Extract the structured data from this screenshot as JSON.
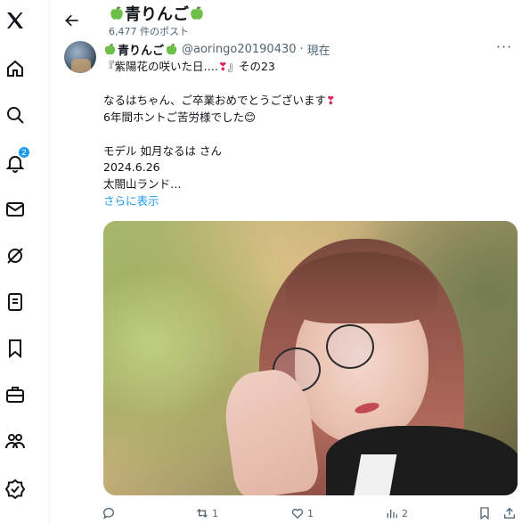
{
  "header": {
    "title": "青りんご",
    "subtitle": "6,477 件のポスト"
  },
  "sidebar": {
    "items": [
      {
        "name": "x-logo-icon"
      },
      {
        "name": "home-icon"
      },
      {
        "name": "search-icon"
      },
      {
        "name": "notifications-icon",
        "badge": "2"
      },
      {
        "name": "messages-icon"
      },
      {
        "name": "grok-icon"
      },
      {
        "name": "lists-icon"
      },
      {
        "name": "bookmarks-icon"
      },
      {
        "name": "jobs-icon"
      },
      {
        "name": "communities-icon"
      },
      {
        "name": "verified-icon"
      }
    ]
  },
  "tweet": {
    "author_name": "青りんご",
    "handle": "@aoringo20190430",
    "separator": "·",
    "time": "現在",
    "more": "···",
    "line1_pre": "『紫陽花の咲いた日….",
    "line1_post": "』その23",
    "line3_pre": "なるはちゃん、ご卒業おめでとうございます",
    "line4": "6年間ホントご苦労様でした😊",
    "line6": "モデル 如月なるは さん",
    "line7": "2024.6.26",
    "line8": "太閤山ランド…",
    "show_more": "さらに表示",
    "heart_glyph": "❣"
  },
  "actions": {
    "retweets": "1",
    "likes": "1",
    "views": "2"
  },
  "colors": {
    "accent": "#1d9bf0",
    "text": "#0f1419",
    "muted": "#536471",
    "apple_green": "#6cc04a"
  }
}
